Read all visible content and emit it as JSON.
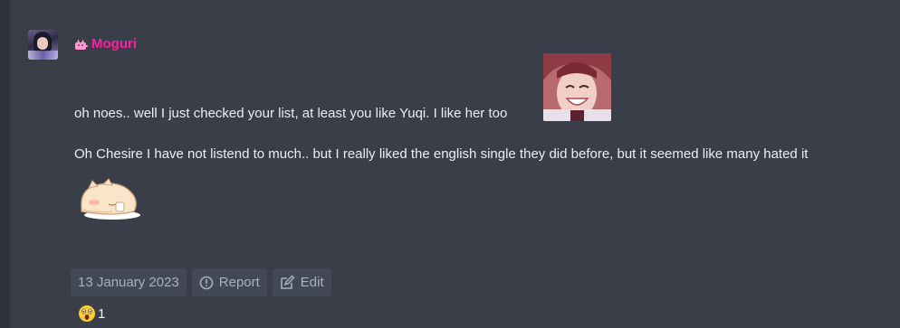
{
  "post": {
    "author": "Moguri",
    "author_icon": "cat-icon",
    "message_line1": "oh noes.. well I just checked your list, at least you like Yuqi. I like her too",
    "message_line2": "Oh Chesire I have not listend to much.. but I really liked the english single they did before, but it seemed like many hated it",
    "date": "13 January 2023",
    "report_label": "Report",
    "edit_label": "Edit",
    "reaction": {
      "emoji": "astonished-face-emoji",
      "count": "1"
    }
  },
  "colors": {
    "background": "#3a3e49",
    "username": "#ff1f9e",
    "chip_bg": "#434856",
    "chip_text": "#a9afbd"
  }
}
